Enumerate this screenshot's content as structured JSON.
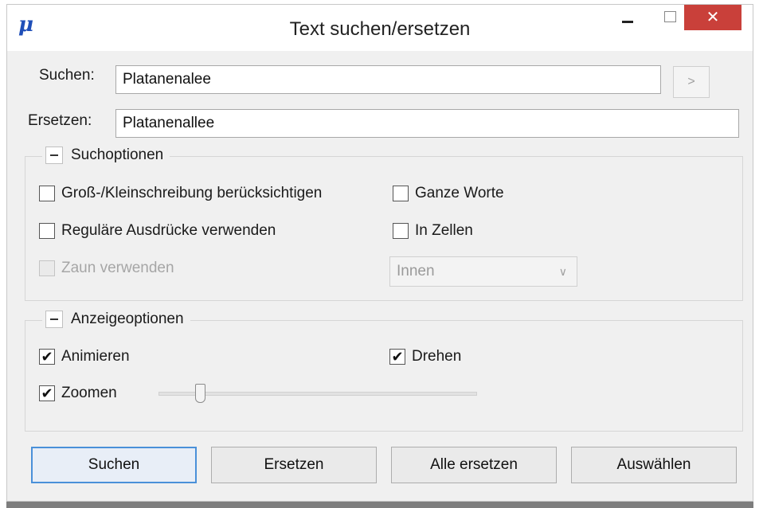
{
  "window": {
    "title": "Text suchen/ersetzen",
    "icon_glyph": "μ",
    "close_glyph": "✕"
  },
  "search": {
    "label": "Suchen:",
    "value": "Platanenalee",
    "next_glyph": ">"
  },
  "replace": {
    "label": "Ersetzen:",
    "value": "Platanenallee"
  },
  "search_options": {
    "title": "Suchoptionen",
    "match_case": {
      "label": "Groß-/Kleinschreibung berücksichtigen",
      "checked": false
    },
    "whole_words": {
      "label": "Ganze Worte",
      "checked": false
    },
    "regex": {
      "label": "Reguläre Ausdrücke verwenden",
      "checked": false
    },
    "in_cells": {
      "label": "In Zellen",
      "checked": false
    },
    "fence": {
      "label": "Zaun verwenden",
      "checked": false,
      "enabled": false
    },
    "fence_mode": {
      "value": "Innen",
      "enabled": false
    }
  },
  "display_options": {
    "title": "Anzeigeoptionen",
    "animate": {
      "label": "Animieren",
      "checked": true
    },
    "rotate": {
      "label": "Drehen",
      "checked": true
    },
    "zoom": {
      "label": "Zoomen",
      "checked": true,
      "level_fraction": 0.12
    }
  },
  "buttons": {
    "search": "Suchen",
    "replace": "Ersetzen",
    "replace_all": "Alle ersetzen",
    "select": "Auswählen"
  },
  "colors": {
    "close_button": "#c9403a",
    "default_button_border": "#4a90d9",
    "app_icon": "#1f4fb8"
  }
}
